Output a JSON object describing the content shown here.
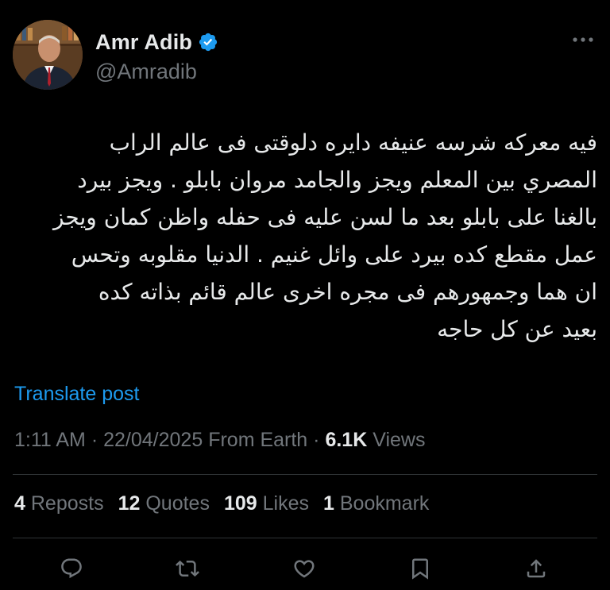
{
  "author": {
    "display_name": "Amr Adib",
    "handle": "@Amradib",
    "verified": true
  },
  "tweet": {
    "text": "فيه معركه شرسه عنيفه دايره دلوقتى فى عالم الراب\nالمصري بين المعلم ويجز والجامد مروان بابلو . ويجز بيرد\nبالغنا على بابلو بعد ما لسن عليه فى حفله واظن كمان ويجز\nعمل مقطع كده بيرد على وائل غنيم . الدنيا مقلوبه وتحس\nان هما وجمهورهم فى مجره اخرى عالم قائم بذاته كده\nبعيد عن كل حاجه",
    "translate_label": "Translate post"
  },
  "meta": {
    "time": "1:11 AM",
    "separator": "·",
    "date": "22/04/2025",
    "source": "From Earth",
    "views_count": "6.1K",
    "views_label": "Views"
  },
  "stats": {
    "reposts_count": "4",
    "reposts_label": "Reposts",
    "quotes_count": "12",
    "quotes_label": "Quotes",
    "likes_count": "109",
    "likes_label": "Likes",
    "bookmarks_count": "1",
    "bookmarks_label": "Bookmark"
  },
  "icons": {
    "verified": "verified-badge-icon",
    "more": "more-dots-icon",
    "reply": "reply-icon",
    "repost": "repost-icon",
    "like": "like-heart-icon",
    "bookmark": "bookmark-icon",
    "share": "share-icon"
  },
  "colors": {
    "background": "#000000",
    "text": "#e7e9ea",
    "secondary": "#71767b",
    "accent": "#1d9bf0",
    "divider": "#2f3336"
  }
}
